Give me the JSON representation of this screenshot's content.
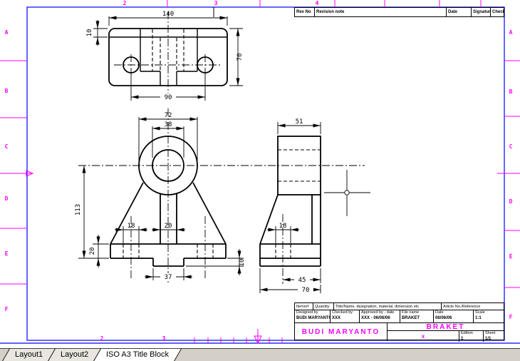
{
  "frame": {
    "left_letters": [
      "A",
      "B",
      "C",
      "D",
      "E",
      "F"
    ],
    "right_letters": [
      "A",
      "B",
      "C",
      "D",
      "E",
      "F"
    ],
    "top_numbers": [
      "2",
      "3",
      "4"
    ],
    "bottom_numbers": [
      "2",
      "3"
    ]
  },
  "revision_table": {
    "rev_no": "Rev No",
    "revision_note": "Revision note",
    "date": "Date",
    "signature": "Signature",
    "checked": "Checked"
  },
  "title_block": {
    "itemref": "Itemref",
    "quantity": "Quantity",
    "title_name": "Title/Name, designation, material, dimension etc",
    "article": "Article No./Reference",
    "designed_label": "Designed by",
    "designed": "BUDI MARYANTO",
    "checked_label": "Checked by",
    "checked": "XXX",
    "approved_label": "Approved by - date",
    "approved": "XXX - 06/06/06",
    "file_label": "File name",
    "file": "BRAKET",
    "date_label": "Date",
    "date": "06/06/06",
    "scale_label": "Scale",
    "scale": "1:1",
    "author": "BUDI MARYANTO",
    "part_title": "BRAKET",
    "mark": "x",
    "edition_label": "Edition",
    "edition": "1",
    "sheet_label": "Sheet",
    "sheet": "1/1"
  },
  "dims": {
    "tv_width": "140",
    "tv_strip": "10",
    "tv_height": "70",
    "tv_holes": "90",
    "fv_boss": "72",
    "fv_bore": "38",
    "fv_height": "113",
    "fv_base_h": "20",
    "fv_hole": "18",
    "fv_stem": "20",
    "fv_tab_w": "37",
    "fv_tab_h": "10",
    "sv_depth": "51",
    "sv_hole": "18",
    "sv_hole_off": "45",
    "sv_base": "70"
  },
  "tabs": {
    "layout1": "Layout1",
    "layout2": "Layout2",
    "iso": "ISO A3 Title Block"
  },
  "colors": {
    "frame_blue": "#0000ff",
    "mark_magenta": "#ff00ff",
    "line_black": "#000000",
    "tabbar_gray": "#d4d0c8"
  }
}
